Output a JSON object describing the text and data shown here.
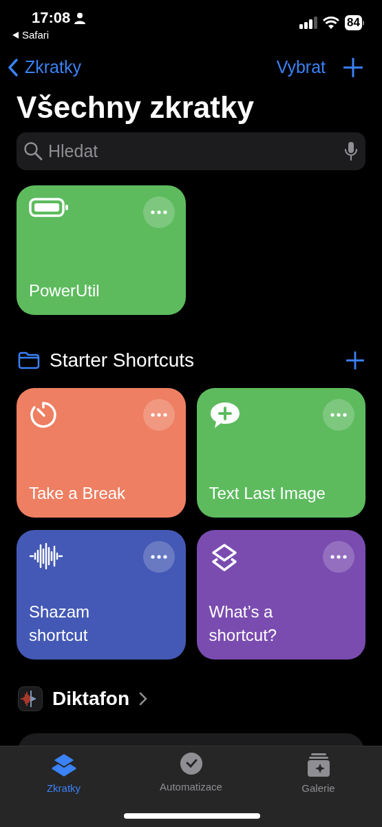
{
  "status_bar": {
    "time": "17:08",
    "back_app": "Safari",
    "battery": "84"
  },
  "nav": {
    "back": "Zkratky",
    "select": "Vybrat"
  },
  "title": "Všechny zkratky",
  "search": {
    "placeholder": "Hledat"
  },
  "top_shortcuts": [
    {
      "name": "PowerUtil",
      "kind": "battery",
      "color": "#5dbb5e"
    }
  ],
  "folder": {
    "name": "Starter Shortcuts",
    "shortcuts": [
      {
        "name": "Take a Break",
        "kind": "timer",
        "color": "#ee7f62"
      },
      {
        "name": "Text Last Image",
        "kind": "message",
        "color": "#5dbb5e"
      },
      {
        "name": "Shazam\nshortcut",
        "kind": "waveform",
        "color": "#4459b5"
      },
      {
        "name": "What’s a\nshortcut?",
        "kind": "layers",
        "color": "#7a4cb0"
      }
    ]
  },
  "app_section": {
    "name": "Diktafon"
  },
  "tab_bar": [
    {
      "label": "Zkratky",
      "kind": "shortcuts",
      "selected": true
    },
    {
      "label": "Automatizace",
      "kind": "automation",
      "selected": false
    },
    {
      "label": "Galerie",
      "kind": "gallery",
      "selected": false
    }
  ]
}
